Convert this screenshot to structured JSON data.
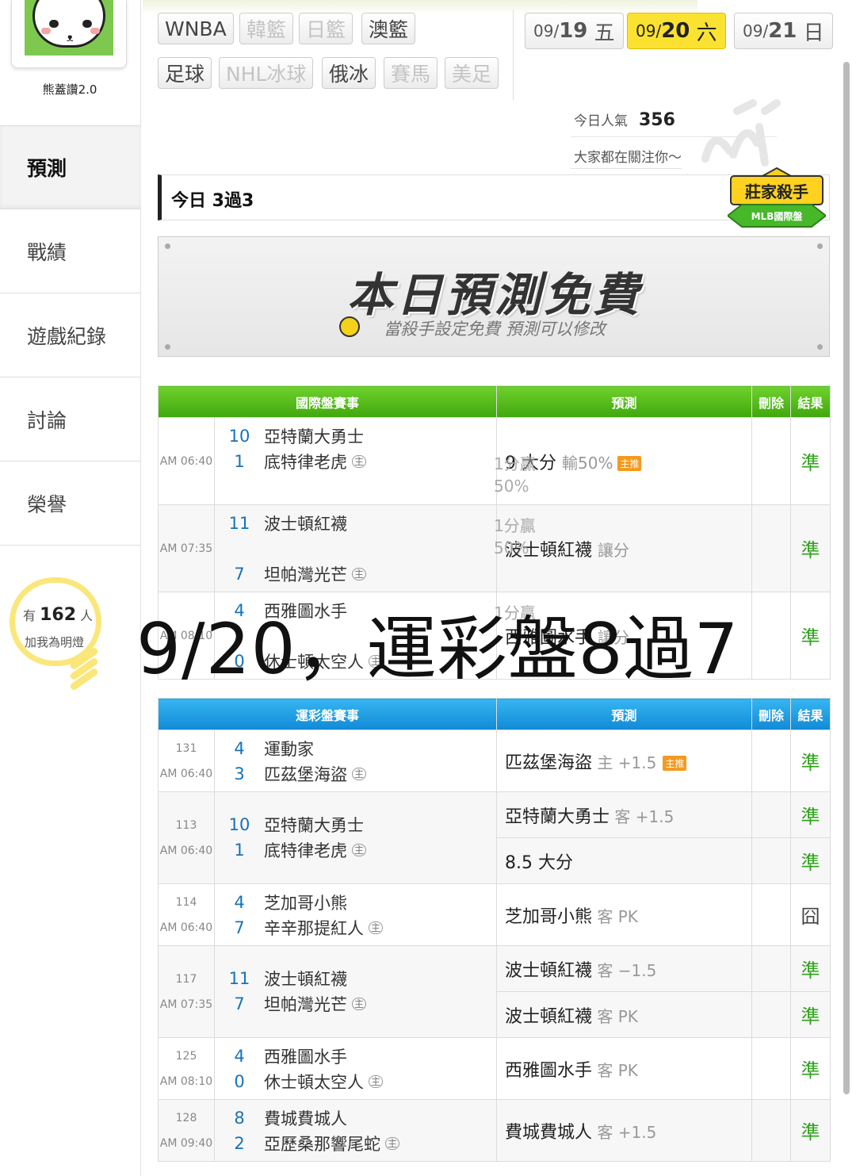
{
  "sidebar": {
    "username": "熊蓋讚2.0",
    "nav": [
      "預測",
      "戰績",
      "遊戲紀錄",
      "討論",
      "榮譽"
    ],
    "fans": {
      "prefix": "有",
      "count": "162",
      "suffix": "人",
      "label": "加我為明燈"
    }
  },
  "filters": {
    "row1": [
      {
        "label": "WNBA",
        "enabled": true
      },
      {
        "label": "韓籃",
        "enabled": false
      },
      {
        "label": "日籃",
        "enabled": false
      },
      {
        "label": "澳籃",
        "enabled": true
      }
    ],
    "row2": [
      {
        "label": "足球",
        "enabled": true
      },
      {
        "label": "NHL冰球",
        "enabled": false
      },
      {
        "label": "俄冰",
        "enabled": true
      },
      {
        "label": "賽馬",
        "enabled": false
      },
      {
        "label": "美足",
        "enabled": false
      }
    ]
  },
  "dates": [
    {
      "md": "09/",
      "day": "19",
      "wd": "五",
      "active": false
    },
    {
      "md": "09/",
      "day": "20",
      "wd": "六",
      "active": true
    },
    {
      "md": "09/",
      "day": "21",
      "wd": "日",
      "active": false
    }
  ],
  "popularity": {
    "label": "今日人氣",
    "value": "356",
    "tagline": "大家都在關注你～"
  },
  "today": {
    "text": "今日 3過3"
  },
  "badge": {
    "title": "莊家殺手",
    "subtitle": "MLB國際盤"
  },
  "banner": {
    "title": "本日預測免費",
    "subtitle": "當殺手設定免費  預測可以修改"
  },
  "intl": {
    "headers": [
      "國際盤賽事",
      "預測",
      "刪除",
      "結果"
    ],
    "rows": [
      {
        "time": "AM 06:40",
        "away": {
          "score": "10",
          "name": "亞特蘭大勇士"
        },
        "home": {
          "score": "1",
          "name": "底特律老虎"
        },
        "note1": "1分贏",
        "note2": "50%",
        "pred": "9 大分",
        "pred_minor": "輸50%",
        "star": "主推",
        "result": "準"
      },
      {
        "time": "AM 07:35",
        "away": {
          "score": "11",
          "name": "波士頓紅襪"
        },
        "home": {
          "score": "7",
          "name": "坦帕灣光芒"
        },
        "note1": "1分贏",
        "note2": "50%",
        "pred": "波士頓紅襪",
        "pred_minor": "讓分",
        "star": "",
        "result": "準"
      },
      {
        "time": "AM 08:10",
        "away": {
          "score": "4",
          "name": "西雅圖水手"
        },
        "home": {
          "score": "0",
          "name": "休士頓太空人"
        },
        "note1": "1分贏",
        "note2": "",
        "pred": "西雅圖水手",
        "pred_minor": "讓分",
        "star": "",
        "result": "準"
      }
    ]
  },
  "sports": {
    "headers": [
      "運彩盤賽事",
      "預測",
      "刪除",
      "結果"
    ],
    "rows": [
      {
        "id": "131",
        "time": "AM 06:40",
        "away": {
          "score": "4",
          "name": "運動家"
        },
        "home": {
          "score": "3",
          "name": "匹茲堡海盜"
        },
        "preds": [
          {
            "team": "匹茲堡海盜",
            "side": "主",
            "line": "+1.5",
            "star": "主推",
            "result": "準"
          }
        ]
      },
      {
        "id": "113",
        "time": "AM 06:40",
        "away": {
          "score": "10",
          "name": "亞特蘭大勇士"
        },
        "home": {
          "score": "1",
          "name": "底特律老虎"
        },
        "preds": [
          {
            "team": "亞特蘭大勇士",
            "side": "客",
            "line": "+1.5",
            "star": "",
            "result": "準"
          },
          {
            "team": "8.5 大分",
            "side": "",
            "line": "",
            "star": "",
            "result": "準"
          }
        ]
      },
      {
        "id": "114",
        "time": "AM 06:40",
        "away": {
          "score": "4",
          "name": "芝加哥小熊"
        },
        "home": {
          "score": "7",
          "name": "辛辛那提紅人"
        },
        "preds": [
          {
            "team": "芝加哥小熊",
            "side": "客",
            "line": "PK",
            "star": "",
            "result": "囧"
          }
        ]
      },
      {
        "id": "117",
        "time": "AM 07:35",
        "away": {
          "score": "11",
          "name": "波士頓紅襪"
        },
        "home": {
          "score": "7",
          "name": "坦帕灣光芒"
        },
        "preds": [
          {
            "team": "波士頓紅襪",
            "side": "客",
            "line": "−1.5",
            "star": "",
            "result": "準"
          },
          {
            "team": "波士頓紅襪",
            "side": "客",
            "line": "PK",
            "star": "",
            "result": "準"
          }
        ]
      },
      {
        "id": "125",
        "time": "AM 08:10",
        "away": {
          "score": "4",
          "name": "西雅圖水手"
        },
        "home": {
          "score": "0",
          "name": "休士頓太空人"
        },
        "preds": [
          {
            "team": "西雅圖水手",
            "side": "客",
            "line": "PK",
            "star": "",
            "result": "準"
          }
        ]
      },
      {
        "id": "128",
        "time": "AM 09:40",
        "away": {
          "score": "8",
          "name": "費城費城人"
        },
        "home": {
          "score": "2",
          "name": "亞歷桑那響尾蛇"
        },
        "preds": [
          {
            "team": "費城費城人",
            "side": "客",
            "line": "+1.5",
            "star": "",
            "result": "準"
          }
        ]
      }
    ]
  },
  "home_marker": "主",
  "overlay": "9/20，運彩盤8過7"
}
